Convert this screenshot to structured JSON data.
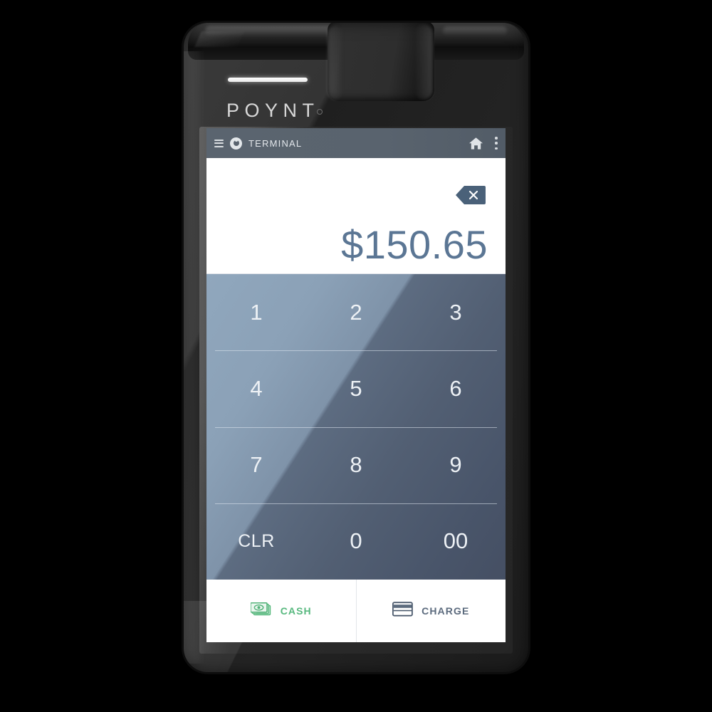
{
  "device": {
    "brand": "POYNT",
    "registered_mark": "®"
  },
  "statusbar": {
    "title": "TERMINAL",
    "menu_icon": "hamburger-menu-icon",
    "app_icon": "poynt-mark-icon",
    "home_icon": "home-icon",
    "overflow_icon": "overflow-menu-icon",
    "background_color": "#59636e",
    "text_color": "#e2e6ea"
  },
  "amount": {
    "value": "$150.65",
    "currency_symbol": "$",
    "text_color": "#5b7694",
    "backspace_icon": "backspace-delete-icon"
  },
  "keypad": {
    "rows": [
      [
        {
          "label": "1"
        },
        {
          "label": "2"
        },
        {
          "label": "3"
        }
      ],
      [
        {
          "label": "4"
        },
        {
          "label": "5"
        },
        {
          "label": "6"
        }
      ],
      [
        {
          "label": "7"
        },
        {
          "label": "8"
        },
        {
          "label": "9"
        }
      ],
      [
        {
          "label": "CLR"
        },
        {
          "label": "0"
        },
        {
          "label": "00"
        }
      ]
    ],
    "key_text_color": "#edf1f5",
    "gradient_from": "#90a7bd",
    "gradient_to": "#454f63"
  },
  "actions": [
    {
      "label": "CASH",
      "icon": "banknote-icon",
      "color": "#57b87e"
    },
    {
      "label": "CHARGE",
      "icon": "credit-card-icon",
      "color": "#5c6b7e"
    }
  ]
}
